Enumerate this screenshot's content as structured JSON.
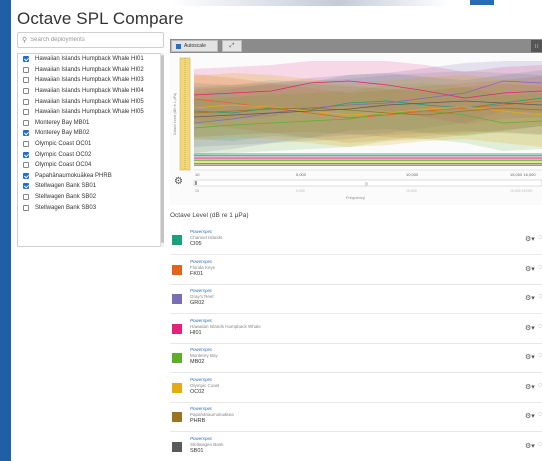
{
  "app": {
    "title": "Octave SPL Compare"
  },
  "search": {
    "placeholder": "Search deployments"
  },
  "deployments": [
    {
      "label": "Hawaiian Islands Humpback Whale HI01",
      "checked": true
    },
    {
      "label": "Hawaiian Islands Humpback Whale HI02",
      "checked": false
    },
    {
      "label": "Hawaiian Islands Humpback Whale HI03",
      "checked": false
    },
    {
      "label": "Hawaiian Islands Humpback Whale HI04",
      "checked": false
    },
    {
      "label": "Hawaiian Islands Humpback Whale HI05",
      "checked": false
    },
    {
      "label": "Hawaiian Islands Humpback Whale HI05",
      "checked": false
    },
    {
      "label": "Monterey Bay MB01",
      "checked": false
    },
    {
      "label": "Monterey Bay MB02",
      "checked": true
    },
    {
      "label": "Olympic Coast OC01",
      "checked": false
    },
    {
      "label": "Olympic Coast OC02",
      "checked": true
    },
    {
      "label": "Olympic Coast OC04",
      "checked": false
    },
    {
      "label": "Papahānaumokuākea PHRB",
      "checked": true
    },
    {
      "label": "Stellwagen Bank SB01",
      "checked": true
    },
    {
      "label": "Stellwagen Bank SB02",
      "checked": false
    },
    {
      "label": "Stellwagen Bank SB03",
      "checked": false
    }
  ],
  "toolbar": {
    "autoscale_label": "Autoscale",
    "expand_icon": "expand-icon",
    "grid_icon": "grid-icon"
  },
  "chart": {
    "ylabel": "Octave Level (dB re 1 μPa)",
    "xlabel": "Frequency",
    "x_ticks": [
      "10",
      "5,000",
      "10,000",
      "15,000 16,000"
    ],
    "range_ticks": [
      "10",
      "5,000",
      "10,000",
      "15,000 16,000"
    ],
    "range_mid_marker": "|||"
  },
  "legend": {
    "title": "Octave Level (dB re 1 μPa)",
    "items": [
      {
        "type": "Powerspec",
        "site": "Channel Islands",
        "code": "CI05",
        "color": "#1aa07a"
      },
      {
        "type": "Powerspec",
        "site": "Florida Keys",
        "code": "FK01",
        "color": "#e5621c"
      },
      {
        "type": "Powerspec",
        "site": "Gray's Reef",
        "code": "GR02",
        "color": "#7b6db5"
      },
      {
        "type": "Powerspec",
        "site": "Hawaiian Islands Humpback Whale",
        "code": "HI01",
        "color": "#e0247a"
      },
      {
        "type": "Powerspec",
        "site": "Monterey Bay",
        "code": "MB02",
        "color": "#5fae2b"
      },
      {
        "type": "Powerspec",
        "site": "Olympic Coast",
        "code": "OC02",
        "color": "#e3ac12"
      },
      {
        "type": "Powerspec",
        "site": "Papahānaumokuākea",
        "code": "PHRB",
        "color": "#9a7323"
      },
      {
        "type": "Powerspec",
        "site": "Stellwagen Bank",
        "code": "SB01",
        "color": "#5a5a5a"
      }
    ]
  },
  "row_icons": {
    "gear": "gear-icon",
    "chevron": "chevron-down-icon"
  }
}
